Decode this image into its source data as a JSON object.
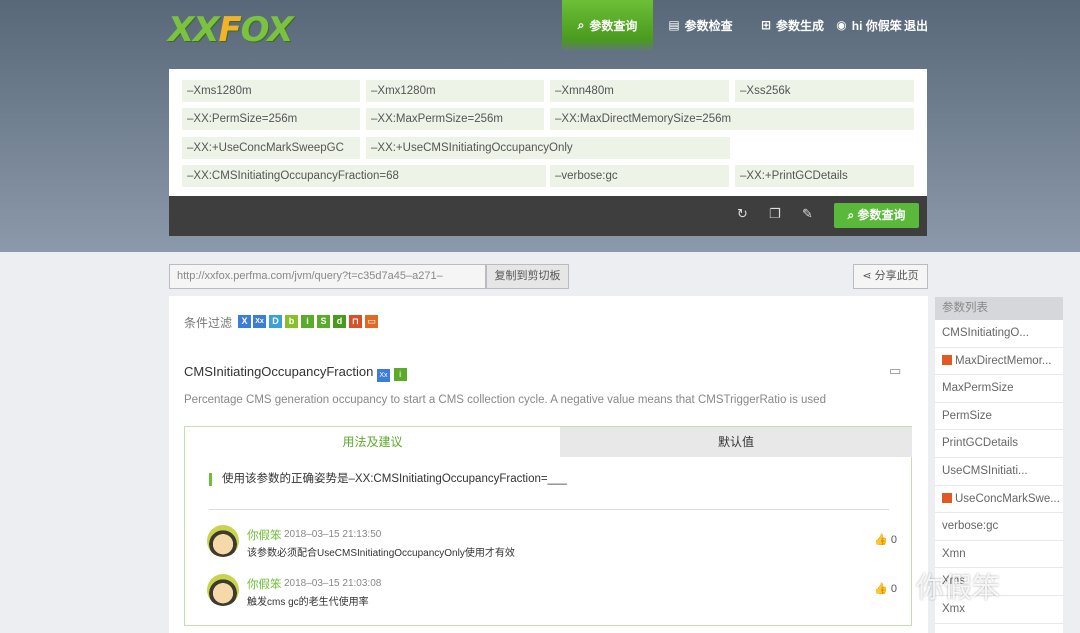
{
  "brand": {
    "logo_text_a": "XX",
    "logo_text_b": "F",
    "logo_text_c": "OX"
  },
  "nav": {
    "query": "参数查询",
    "check": "参数检查",
    "generate": "参数生成",
    "user": "hi 你假笨",
    "logout": "退出"
  },
  "params": [
    "–Xms1280m",
    "–Xmx1280m",
    "–Xmn480m",
    "–Xss256k",
    "–XX:PermSize=256m",
    "–XX:MaxPermSize=256m",
    "–XX:MaxDirectMemorySize=256m",
    "–XX:+UseConcMarkSweepGC",
    "–XX:+UseCMSInitiatingOccupancyOnly",
    "–XX:CMSInitiatingOccupancyFraction=68",
    "–verbose:gc",
    "–XX:+PrintGCDetails"
  ],
  "toolbar": {
    "query_button": "参数查询"
  },
  "share": {
    "url": "http://xxfox.perfma.com/jvm/query?t=c35d7a45–a271–",
    "copy_button": "复制到剪切板",
    "share_button": "分享此页"
  },
  "filter": {
    "label": "条件过滤",
    "badges": [
      {
        "text": "X",
        "color": "#3b7dd8"
      },
      {
        "text": "Xx",
        "color": "#3b7dd8"
      },
      {
        "text": "D",
        "color": "#3b9fd8"
      },
      {
        "text": "b",
        "color": "#8bbf2a"
      },
      {
        "text": "i",
        "color": "#5aab2a"
      },
      {
        "text": "S",
        "color": "#5aab2a"
      },
      {
        "text": "d",
        "color": "#4a9a1e"
      },
      {
        "text": "⊓",
        "color": "#d8502a"
      },
      {
        "text": "▭",
        "color": "#e06a25"
      }
    ]
  },
  "param_detail": {
    "name": "CMSInitiatingOccupancyFraction",
    "badge_a": "Xx",
    "badge_b": "i",
    "description": "Percentage CMS generation occupancy to start a CMS collection cycle. A negative value means that CMSTriggerRatio is used",
    "tab_usage": "用法及建议",
    "tab_default": "默认值",
    "usage_text": "使用该参数的正确姿势是–XX:CMSInitiatingOccupancyFraction=___"
  },
  "comments": [
    {
      "user": "你假笨",
      "time": "2018–03–15 21:13:50",
      "text": "该参数必须配合UseCMSInitiatingOccupancyOnly使用才有效",
      "likes": "0"
    },
    {
      "user": "你假笨",
      "time": "2018–03–15 21:03:08",
      "text": "触发cms gc的老生代使用率",
      "likes": "0"
    }
  ],
  "sidebar": {
    "title": "参数列表",
    "items": [
      {
        "label": "CMSInitiatingO...",
        "flag": false
      },
      {
        "label": "MaxDirectMemor...",
        "flag": true
      },
      {
        "label": "MaxPermSize",
        "flag": false
      },
      {
        "label": "PermSize",
        "flag": false
      },
      {
        "label": "PrintGCDetails",
        "flag": false
      },
      {
        "label": "UseCMSInitiati...",
        "flag": false
      },
      {
        "label": "UseConcMarkSwe...",
        "flag": true
      },
      {
        "label": "verbose:gc",
        "flag": false
      },
      {
        "label": "Xmn",
        "flag": false
      },
      {
        "label": "Xms",
        "flag": false
      },
      {
        "label": "Xmx",
        "flag": false
      }
    ]
  },
  "watermark": "你假笨"
}
